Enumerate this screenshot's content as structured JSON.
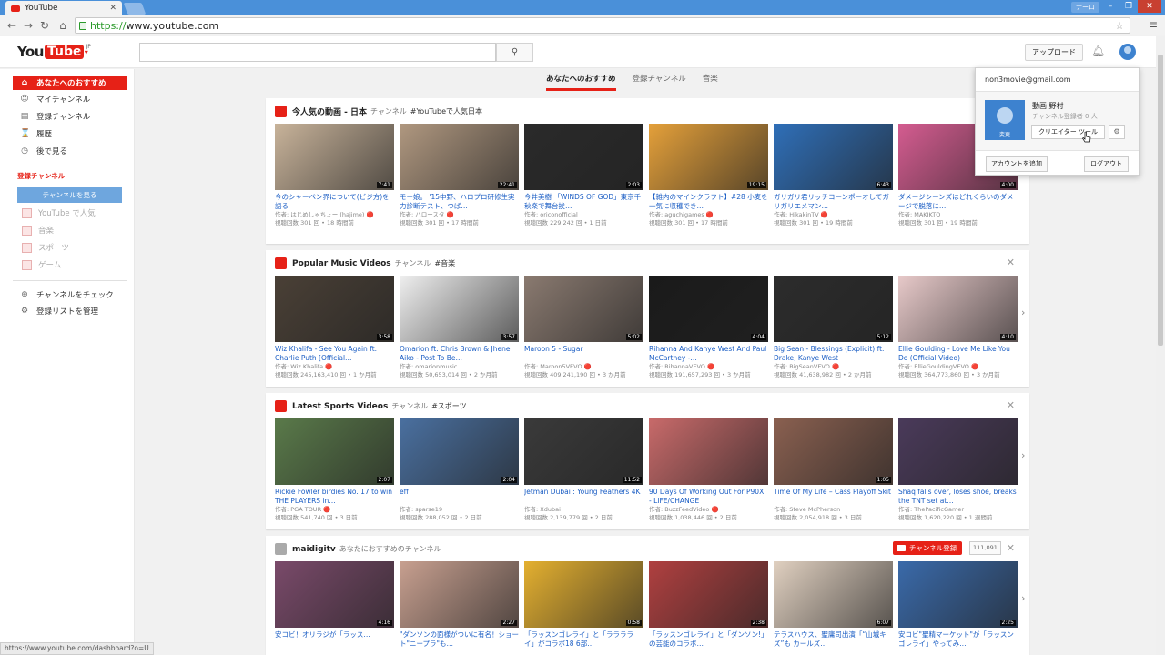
{
  "browser": {
    "tab_title": "YouTube",
    "user_label": "ナーロ",
    "url_scheme": "https://",
    "url_rest": "www.youtube.com"
  },
  "masthead": {
    "logo_you": "You",
    "logo_tube": "Tube",
    "logo_region": "JP",
    "upload_label": "アップロード"
  },
  "sidebar": {
    "items": [
      {
        "label": "あなたへのおすすめ",
        "icon": "home-icon",
        "glyph": "⌂"
      },
      {
        "label": "マイチャンネル",
        "icon": "person-icon",
        "glyph": "☺"
      },
      {
        "label": "登録チャンネル",
        "icon": "subscriptions-icon",
        "glyph": "▤"
      },
      {
        "label": "履歴",
        "icon": "history-icon",
        "glyph": "⌛"
      },
      {
        "label": "後で見る",
        "icon": "clock-icon",
        "glyph": "◷"
      }
    ],
    "section_title": "登録チャンネル",
    "browse_button": "チャンネルを見る",
    "subs": [
      "YouTube で人気",
      "音楽",
      "スポーツ",
      "ゲーム"
    ],
    "bottom_items": [
      {
        "label": "チャンネルをチェック",
        "icon": "add-circle-icon",
        "glyph": "⊕"
      },
      {
        "label": "登録リストを管理",
        "icon": "gear-icon",
        "glyph": "⚙"
      }
    ]
  },
  "main_tabs": [
    "あなたへのおすすめ",
    "登録チャンネル",
    "音楽"
  ],
  "shelves": [
    {
      "title": "今人気の動画 - 日本",
      "meta": "チャンネル",
      "tag": "#YouTubeで人気日本",
      "videos": [
        {
          "title": "今のシャーペン界について(ビジ方)を語る",
          "by": "作者: はじめしゃちょー (hajime) 🔴",
          "views": "視聴回数 301 回 • 18 時間前",
          "dur": "7:41",
          "color": "#c8b39a"
        },
        {
          "title": "モー娘。 '15中野、ハロプロ研修生実力診断テスト、つば…",
          "by": "作者: ハロースタ 🔴",
          "views": "視聴回数 301 回 • 17 時間前",
          "dur": "22:41",
          "color": "#b09880"
        },
        {
          "title": "今井美樹 「WINDS OF GOD」東京千秋楽で舞台挨…",
          "by": "作者: oriconofficial",
          "views": "視聴回数 229,242 回 • 1 日前",
          "dur": "2:03",
          "color": "#2a2a2a"
        },
        {
          "title": "【雑内のマインクラフト】#28 小麦を一気に収穫でき…",
          "by": "作者: aguchigames 🔴",
          "views": "視聴回数 301 回 • 17 時間前",
          "dur": "19:15",
          "color": "#e4a03a"
        },
        {
          "title": "ガリガリ君リッチコーンポーオしてガリガリエメマン…",
          "by": "作者: HikakinTV 🔴",
          "views": "視聴回数 301 回 • 19 時間前",
          "dur": "6:43",
          "color": "#2f6fb8"
        },
        {
          "title": "ダメージシーンズはどれくらいのダメージで脱落に…",
          "by": "作者: MAKIKTO",
          "views": "視聴回数 301 回 • 19 時間前",
          "dur": "4:00",
          "color": "#d45c90"
        }
      ]
    },
    {
      "title": "Popular Music Videos",
      "meta": "チャンネル",
      "tag": "#音楽",
      "videos": [
        {
          "title": "Wiz Khalifa - See You Again ft. Charlie Puth [Official…",
          "by": "作者: Wiz Khalifa 🔴",
          "views": "視聴回数 245,163,410 回 • 1 か月前",
          "dur": "3:58",
          "color": "#4a4036"
        },
        {
          "title": "Omarion ft. Chris Brown & Jhene Aiko - Post To Be…",
          "by": "作者: omarionmusic",
          "views": "視聴回数 50,653,014 回 • 2 か月前",
          "dur": "3:57",
          "color": "#efefef"
        },
        {
          "title": "Maroon 5 - Sugar",
          "by": "作者: Maroon5VEVO 🔴",
          "views": "視聴回数 409,241,190 回 • 3 か月前",
          "dur": "5:02",
          "color": "#8a7a70"
        },
        {
          "title": "Rihanna And Kanye West And Paul McCartney -…",
          "by": "作者: RihannaVEVO 🔴",
          "views": "視聴回数 191,657,293 回 • 3 か月前",
          "dur": "4:04",
          "color": "#1a1a1a"
        },
        {
          "title": "Big Sean - Blessings (Explicit) ft. Drake, Kanye West",
          "by": "作者: BigSeanVEVO 🔴",
          "views": "視聴回数 41,638,982 回 • 2 か月前",
          "dur": "5:12",
          "color": "#2c2c2c"
        },
        {
          "title": "Ellie Goulding - Love Me Like You Do (Official Video)",
          "by": "作者: EllieGouldingVEVO 🔴",
          "views": "視聴回数 364,773,860 回 • 3 か月前",
          "dur": "4:10",
          "color": "#e7c9c9"
        }
      ]
    },
    {
      "title": "Latest Sports Videos",
      "meta": "チャンネル",
      "tag": "#スポーツ",
      "videos": [
        {
          "title": "Rickie Fowler birdies No. 17 to win THE PLAYERS in…",
          "by": "作者: PGA TOUR 🔴",
          "views": "視聴回数 541,740 回 • 3 日前",
          "dur": "2:07",
          "color": "#5a7a4a"
        },
        {
          "title": "eff",
          "by": "作者: sparse19",
          "views": "視聴回数 288,052 回 • 2 日前",
          "dur": "2:04",
          "color": "#4a70a0"
        },
        {
          "title": "Jetman Dubai : Young Feathers 4K",
          "by": "作者: Xdubai",
          "views": "視聴回数 2,139,779 回 • 2 日前",
          "dur": "11:52",
          "color": "#3a3a3a"
        },
        {
          "title": "90 Days Of Working Out For P90X - LIFE/CHANGE",
          "by": "作者: BuzzFeedVideo 🔴",
          "views": "視聴回数 1,038,446 回 • 2 日前",
          "dur": "",
          "color": "#c86a6a"
        },
        {
          "title": "Time Of My Life – Cass Playoff Skit",
          "by": "作者: Steve McPherson",
          "views": "視聴回数 2,054,918 回 • 3 日前",
          "dur": "1:05",
          "color": "#8a6050"
        },
        {
          "title": "Shaq falls over, loses shoe, breaks the TNT set at…",
          "by": "作者: ThePacificGamer",
          "views": "視聴回数 1,620,220 回 • 1 週間前",
          "dur": "",
          "color": "#4a3a5a"
        }
      ]
    },
    {
      "title": "maidigitv",
      "meta": "あなたにおすすめのチャンネル",
      "tag": "",
      "subscribe_label": "チャンネル登録",
      "subscribe_count": "111,091",
      "videos": [
        {
          "title": "安コビ！オリラジが「ラッス…",
          "by": "",
          "views": "",
          "dur": "4:16",
          "color": "#7a4a6a"
        },
        {
          "title": "\"ダンソンの面様がついに有名！ショート\"ニープラ\"も…",
          "by": "",
          "views": "",
          "dur": "2:27",
          "color": "#c8a090"
        },
        {
          "title": "「ラッスンゴレライ」と「ラララライ」がコラボ18 6部…",
          "by": "",
          "views": "",
          "dur": "0:58",
          "color": "#e4b030"
        },
        {
          "title": "「ラッスンゴレライ」と「ダンソン!」の芸能のコラボ…",
          "by": "",
          "views": "",
          "dur": "2:38",
          "color": "#b04040"
        },
        {
          "title": "テラスハウス、聖庸司出演「“山城キズ”も カールズ…",
          "by": "",
          "views": "",
          "dur": "6:07",
          "color": "#e0d0c0"
        },
        {
          "title": "安コビ\"聖精マーケット\"が「ラッスンゴレライ」やってみ…",
          "by": "",
          "views": "",
          "dur": "2:25",
          "color": "#3a6aaa"
        }
      ]
    }
  ],
  "account_popup": {
    "email": "non3movie@gmail.com",
    "name": "動画 野村",
    "subs": "チャンネル登録者 0 人",
    "pic_label": "変更",
    "creator_studio": "クリエイター ツール",
    "add_account": "アカウントを追加",
    "logout": "ログアウト"
  },
  "status_url": "https://www.youtube.com/dashboard?o=U"
}
